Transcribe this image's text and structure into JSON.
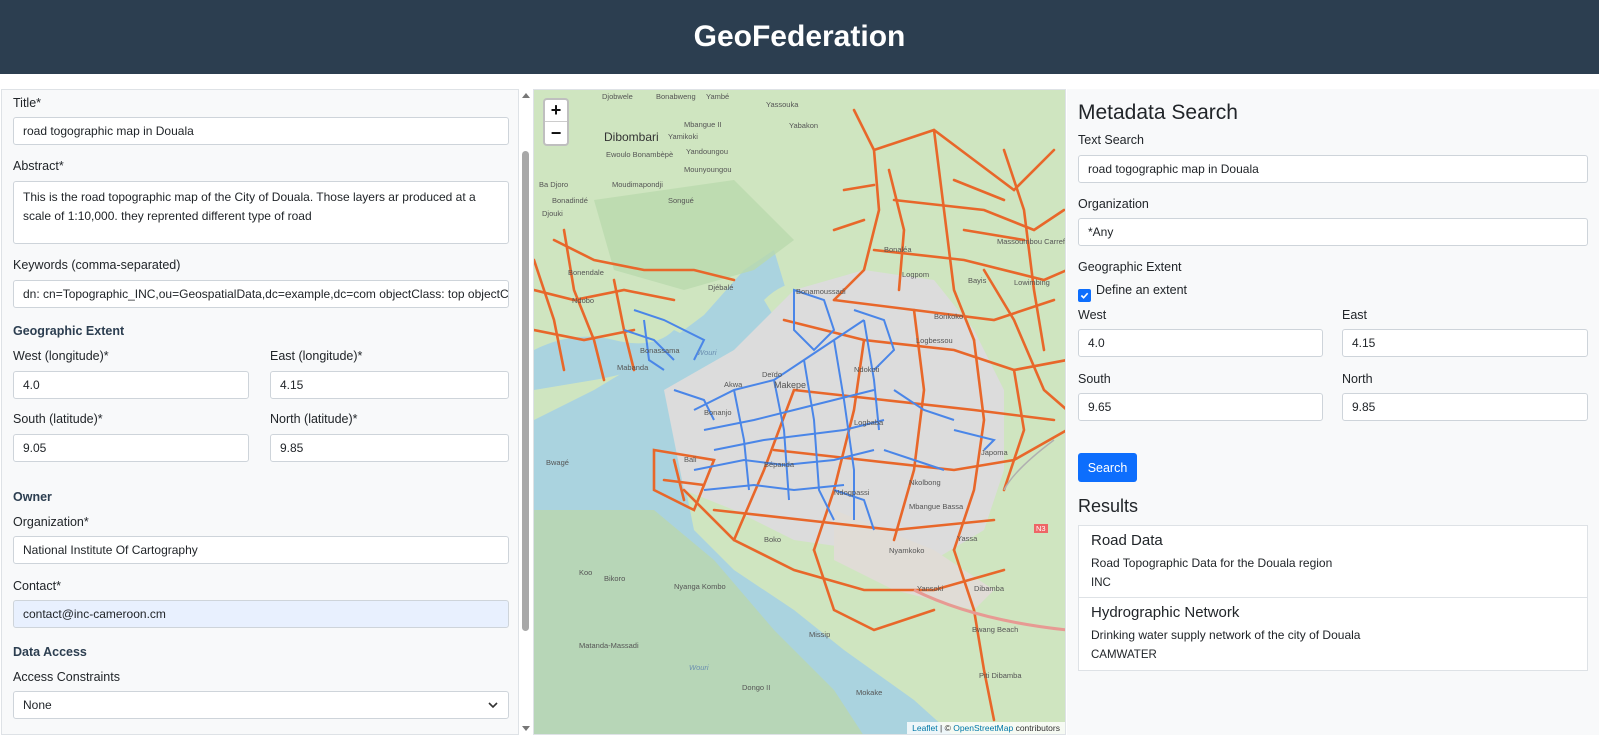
{
  "header": {
    "title": "GeoFederation"
  },
  "form": {
    "title_label": "Title*",
    "title_value": "road togographic map in Douala",
    "abstract_label": "Abstract*",
    "abstract_value": "This is the road topographic map of the City of Douala. Those layers ar produced at a scale of 1:10,000. they reprented different type of road",
    "keywords_label": "Keywords (comma-separated)",
    "keywords_value": "dn: cn=Topographic_INC,ou=GeospatialData,dc=example,dc=com objectClass: top objectClass",
    "extent_heading": "Geographic Extent",
    "west_label": "West (longitude)*",
    "west_value": "4.0",
    "east_label": "East (longitude)*",
    "east_value": "4.15",
    "south_label": "South (latitude)*",
    "south_value": "9.05",
    "north_label": "North (latitude)*",
    "north_value": "9.85",
    "owner_heading": "Owner",
    "org_label": "Organization*",
    "org_value": "National Institute Of Cartography",
    "contact_label": "Contact*",
    "contact_value": "contact@inc-cameroon.cm",
    "access_heading": "Data Access",
    "constraints_label": "Access Constraints",
    "constraints_value": "None"
  },
  "map": {
    "zoom_in": "+",
    "zoom_out": "−",
    "attribution_leaflet": "Leaflet",
    "attribution_sep": " | © ",
    "attribution_osm": "OpenStreetMap",
    "attribution_tail": " contributors",
    "labels": [
      "Djobwele",
      "Bonabweng",
      "Yambé",
      "Yassouka",
      "Yabakon",
      "Dibombari",
      "Mbangue II",
      "Yamikoki",
      "Ewoulo Bonambèpè",
      "Yandoungou",
      "Moudimapondji",
      "Mounyoungou",
      "Ba Djoro",
      "Songué",
      "Bonadindé",
      "Djouki",
      "Bonendale",
      "Ndobo",
      "Djébalé",
      "Bonamoussadi",
      "Bonaléa",
      "Logpom",
      "Massoumbou Carrefour",
      "Bayis",
      "Lowimbing",
      "Bonkoko",
      "Logbessou",
      "Mabanda",
      "Bonassama",
      "Wouri",
      "Akwa",
      "Deïdo",
      "Ndokoti",
      "Makepe",
      "Bonanjo",
      "Bali",
      "Bépanda",
      "Logbaba",
      "Japoma",
      "Bwagé",
      "Ndogpassi",
      "Nkolbong",
      "Mbangue Bassa",
      "Yassa",
      "N3",
      "Nyamkoko",
      "Boko",
      "Koo",
      "Bikoro",
      "Nyanga Kombo",
      "Yansoki",
      "Dibamba",
      "Missip",
      "Bwang Beach",
      "Matanda-Massadi",
      "Wouri",
      "Dongo II",
      "Mokake",
      "Piti Dibamba"
    ]
  },
  "search": {
    "title": "Metadata Search",
    "text_label": "Text Search",
    "text_value": "road togographic map in Douala",
    "org_label": "Organization",
    "org_value": "*Any",
    "extent_label": "Geographic Extent",
    "define_extent_label": "Define an extent",
    "define_extent_checked": true,
    "west_label": "West",
    "west_value": "4.0",
    "east_label": "East",
    "east_value": "4.15",
    "south_label": "South",
    "south_value": "9.65",
    "north_label": "North",
    "north_value": "9.85",
    "search_button": "Search",
    "results_heading": "Results",
    "results": [
      {
        "title": "Road Data",
        "description": "Road Topographic Data for the Douala region",
        "organization": "INC"
      },
      {
        "title": "Hydrographic Network",
        "description": "Drinking water supply network of the city of Douala",
        "organization": "CAMWATER"
      }
    ]
  },
  "colors": {
    "header_bg": "#2c3e50",
    "primary": "#0d6efd",
    "road_orange": "#e8672a",
    "water_blue": "#4a86e8"
  }
}
